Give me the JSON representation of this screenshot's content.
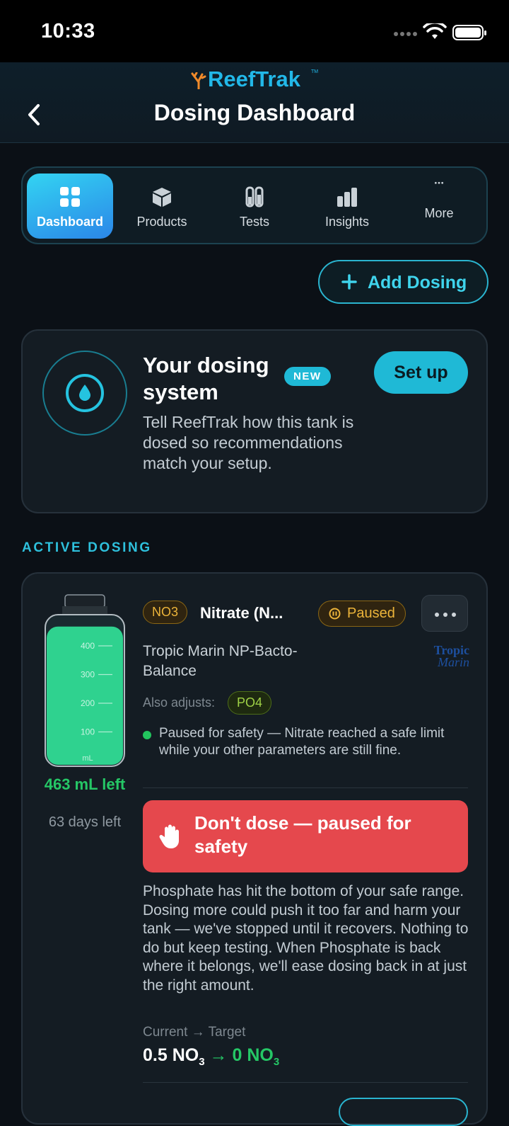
{
  "status_bar": {
    "time": "10:33"
  },
  "header": {
    "brand": "ReefTrak",
    "trademark": "TM",
    "title": "Dosing Dashboard"
  },
  "tabs": [
    {
      "label": "Dashboard",
      "icon": "grid-icon",
      "active": true
    },
    {
      "label": "Products",
      "icon": "box-icon"
    },
    {
      "label": "Tests",
      "icon": "test-tubes-icon"
    },
    {
      "label": "Insights",
      "icon": "bar-chart-icon"
    },
    {
      "label": "More",
      "icon": "more-dots-icon"
    }
  ],
  "add_dosing": {
    "label": "Add Dosing"
  },
  "setup_card": {
    "title": "Your dosing system",
    "badge": "NEW",
    "body": "Tell ReefTrak how this tank is dosed so recommendations match your setup.",
    "button": "Set up"
  },
  "section_label": "ACTIVE DOSING",
  "dosing_card": {
    "bottle": {
      "ticks": [
        "400",
        "300",
        "200",
        "100"
      ],
      "unit": "mL",
      "fill_level": 0.93,
      "fill_color": "#2fd28f"
    },
    "remaining": "463 mL left",
    "days_left": "63 days left",
    "param_chip": "NO3",
    "param_name": "Nitrate (N...",
    "status_chip": "Paused",
    "brand_line1": "Tropic",
    "brand_line2": "Marin",
    "product_name": "Tropic Marin NP-Bacto-Balance",
    "also_label": "Also adjusts:",
    "also_chip": "PO4",
    "status_note": "Paused for safety — Nitrate reached a safe limit while your other parameters are still fine.",
    "alert_text": "Don't dose — paused for safety",
    "explanation": "Phosphate has hit the bottom of your safe range. Dosing more could push it too far and harm your tank — we've stopped until it recovers. Nothing to do but keep testing. When Phosphate is back where it belongs, we'll ease dosing back in at just the right amount.",
    "current_target_label": "Current → Target",
    "current_value": "0.5",
    "target_value": "0",
    "unit_base": "NO",
    "unit_sub": "3"
  },
  "colors": {
    "accent": "#1fb9d6",
    "alert": "#e5484d",
    "success": "#25c766",
    "warning": "#ecb43a"
  }
}
